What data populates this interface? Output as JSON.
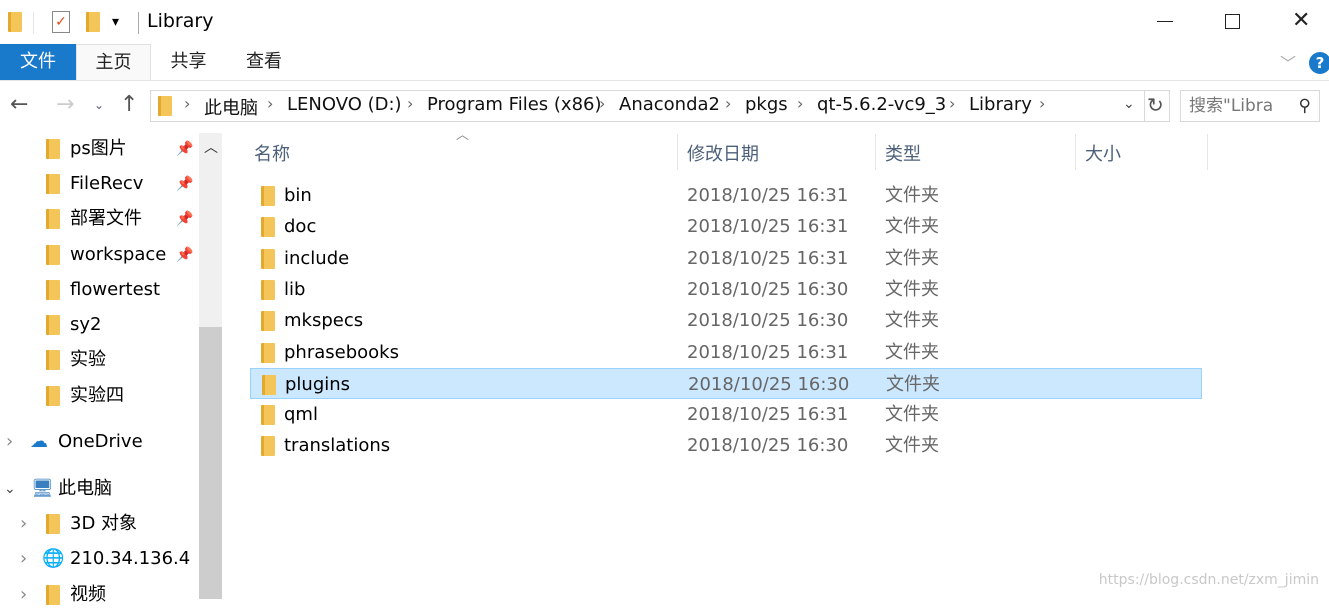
{
  "window": {
    "title": "Library"
  },
  "ribbon": {
    "tabs": [
      {
        "label": "文件"
      },
      {
        "label": "主页"
      },
      {
        "label": "共享"
      },
      {
        "label": "查看"
      }
    ],
    "file_color": "#1979ca"
  },
  "address": {
    "crumbs": [
      "此电脑",
      "LENOVO (D:)",
      "Program Files (x86)",
      "Anaconda2",
      "pkgs",
      "qt-5.6.2-vc9_3",
      "Library"
    ]
  },
  "search": {
    "placeholder": "搜索\"Libra"
  },
  "sidebar": {
    "quick": [
      {
        "label": "ps图片",
        "pinned": true
      },
      {
        "label": "FileRecv",
        "pinned": true
      },
      {
        "label": "部署文件",
        "pinned": true
      },
      {
        "label": "workspace",
        "pinned": true
      },
      {
        "label": "flowertest"
      },
      {
        "label": "sy2"
      },
      {
        "label": "实验"
      },
      {
        "label": "实验四"
      }
    ],
    "onedrive": "OneDrive",
    "thispc": "此电脑",
    "pc_children": [
      "3D 对象",
      "210.34.136.4",
      "视频"
    ]
  },
  "columns": {
    "name": "名称",
    "date": "修改日期",
    "type": "类型",
    "size": "大小"
  },
  "files": [
    {
      "name": "bin",
      "date": "2018/10/25 16:31",
      "type": "文件夹"
    },
    {
      "name": "doc",
      "date": "2018/10/25 16:31",
      "type": "文件夹"
    },
    {
      "name": "include",
      "date": "2018/10/25 16:31",
      "type": "文件夹"
    },
    {
      "name": "lib",
      "date": "2018/10/25 16:30",
      "type": "文件夹"
    },
    {
      "name": "mkspecs",
      "date": "2018/10/25 16:30",
      "type": "文件夹"
    },
    {
      "name": "phrasebooks",
      "date": "2018/10/25 16:31",
      "type": "文件夹"
    },
    {
      "name": "plugins",
      "date": "2018/10/25 16:30",
      "type": "文件夹",
      "selected": true
    },
    {
      "name": "qml",
      "date": "2018/10/25 16:31",
      "type": "文件夹"
    },
    {
      "name": "translations",
      "date": "2018/10/25 16:30",
      "type": "文件夹"
    }
  ],
  "watermark": "https://blog.csdn.net/zxm_jimin"
}
